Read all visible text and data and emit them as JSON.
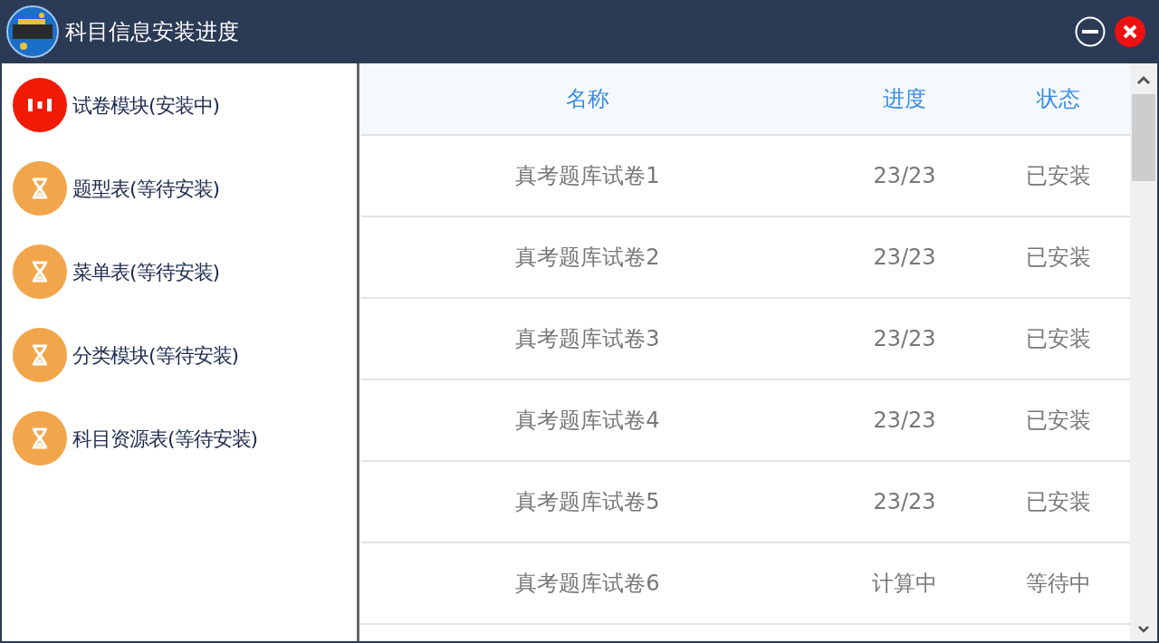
{
  "window": {
    "title": "科目信息安装进度"
  },
  "modules": [
    {
      "label": "试卷模块(安装中)",
      "kind": "installing"
    },
    {
      "label": "题型表(等待安装)",
      "kind": "waiting"
    },
    {
      "label": "菜单表(等待安装)",
      "kind": "waiting"
    },
    {
      "label": "分类模块(等待安装)",
      "kind": "waiting"
    },
    {
      "label": "科目资源表(等待安装)",
      "kind": "waiting"
    }
  ],
  "table": {
    "columns": [
      "名称",
      "进度",
      "状态"
    ],
    "rows": [
      [
        "真考题库试卷1",
        "23/23",
        "已安装"
      ],
      [
        "真考题库试卷2",
        "23/23",
        "已安装"
      ],
      [
        "真考题库试卷3",
        "23/23",
        "已安装"
      ],
      [
        "真考题库试卷4",
        "23/23",
        "已安装"
      ],
      [
        "真考题库试卷5",
        "23/23",
        "已安装"
      ],
      [
        "真考题库试卷6",
        "计算中",
        "等待中"
      ]
    ]
  }
}
